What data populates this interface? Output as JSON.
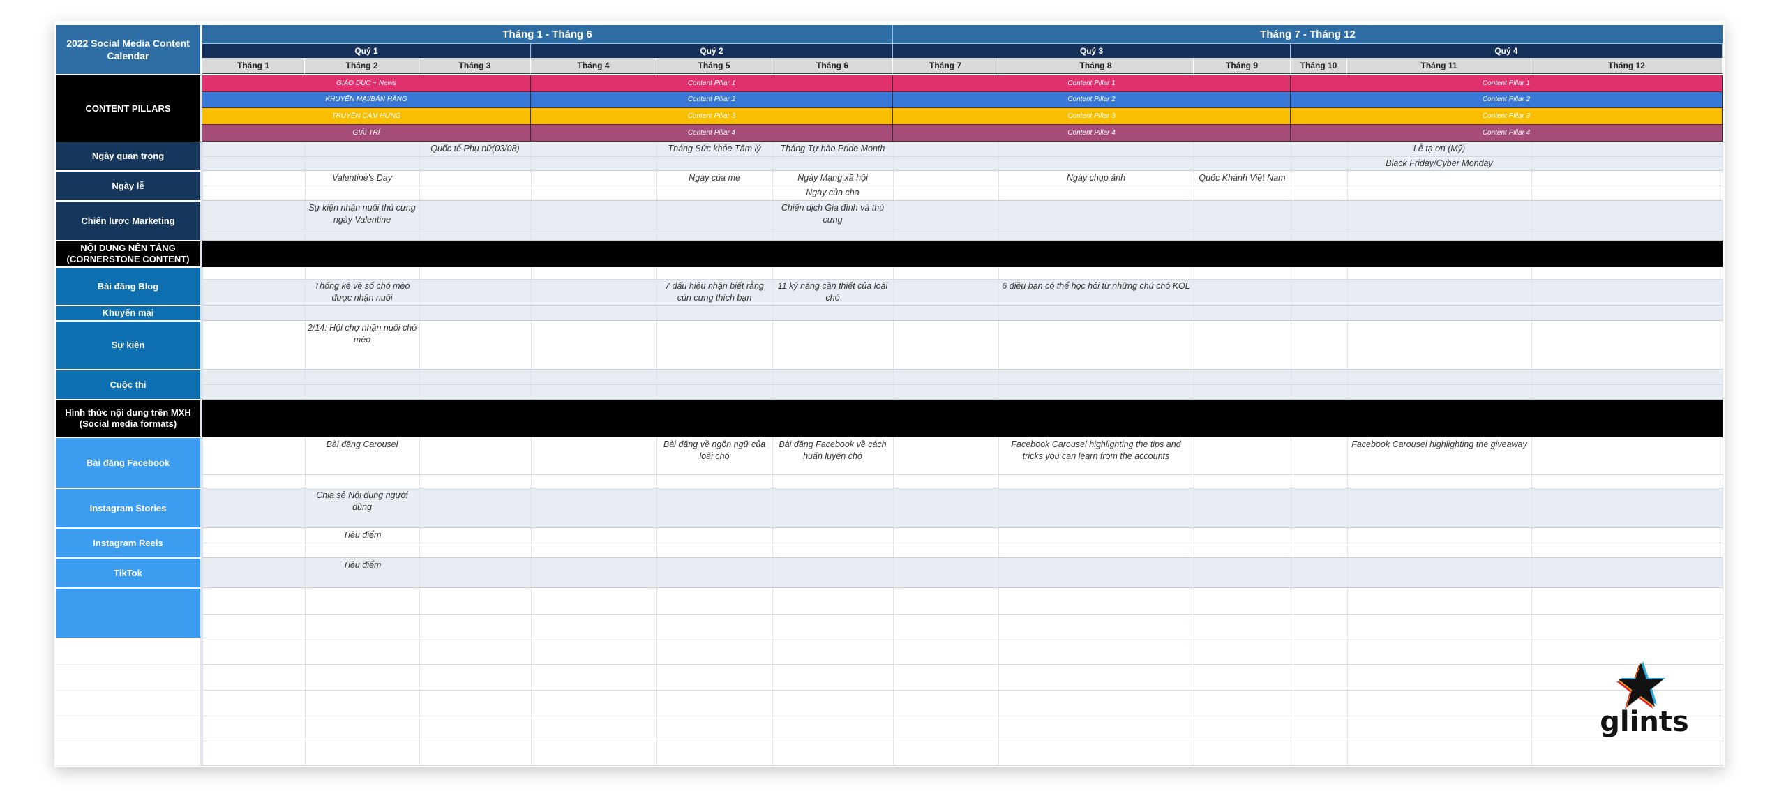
{
  "title": "2022 Social Media Content Calendar",
  "halves": [
    "Tháng 1 - Tháng 6",
    "Tháng 7 - Tháng 12"
  ],
  "quarters": [
    "Quý 1",
    "Quý 2",
    "Quý 3",
    "Quý 4"
  ],
  "months": [
    "Tháng 1",
    "Tháng 2",
    "Tháng 3",
    "Tháng 4",
    "Tháng 5",
    "Tháng 6",
    "Tháng 7",
    "Tháng 8",
    "Tháng 9",
    "Tháng 10",
    "Tháng 11",
    "Tháng 12"
  ],
  "content_pillars": {
    "label": "CONTENT PILLARS",
    "colors": [
      "#e0306e",
      "#3a78d8",
      "#f9be00",
      "#a54d78"
    ],
    "quarters": [
      [
        "GIÁO DỤC + News",
        "KHUYẾN MẠI/BÁN HÀNG",
        "TRUYỀN CẢM HỨNG",
        "GIẢI TRÍ"
      ],
      [
        "Content Pillar 1",
        "Content Pillar 2",
        "Content Pillar 3",
        "Content Pillar 4"
      ],
      [
        "Content Pillar 1",
        "Content Pillar 2",
        "Content Pillar 3",
        "Content Pillar 4"
      ],
      [
        "Content Pillar 1",
        "Content Pillar 2",
        "Content Pillar 3",
        "Content Pillar 4"
      ]
    ]
  },
  "rows": [
    {
      "label": "Ngày quan trọng",
      "entries": [
        {
          "month": 3,
          "line": 1,
          "text": "Quốc tế Phụ nữ(03/08)"
        },
        {
          "month": 5,
          "line": 1,
          "text": "Tháng Sức khỏe Tâm lý"
        },
        {
          "month": 6,
          "line": 1,
          "text": "Tháng Tự hào Pride Month"
        },
        {
          "month": 11,
          "line": 1,
          "text": "Lễ tạ ơn (Mỹ)"
        },
        {
          "month": 11,
          "line": 2,
          "text": "Black Friday/Cyber Monday"
        }
      ]
    },
    {
      "label": "Ngày lễ",
      "entries": [
        {
          "month": 2,
          "line": 1,
          "text": "Valentine's Day"
        },
        {
          "month": 5,
          "line": 1,
          "text": "Ngày của mẹ"
        },
        {
          "month": 6,
          "line": 1,
          "text": "Ngày Mạng xã hội"
        },
        {
          "month": 6,
          "line": 2,
          "text": "Ngày của cha"
        },
        {
          "month": 8,
          "line": 1,
          "text": "Ngày chụp ảnh"
        },
        {
          "month": 9,
          "line": 1,
          "text": "Quốc Khánh Việt Nam"
        }
      ]
    },
    {
      "label": "Chiến lược Marketing",
      "entries": [
        {
          "month": 2,
          "line": 1,
          "text": "Sự kiện nhận nuôi thú cưng ngày Valentine"
        },
        {
          "month": 6,
          "line": 1,
          "text": "Chiến dịch Gia đình và thú cưng"
        }
      ]
    },
    {
      "label": "NỘI DUNG NỀN TẢNG (CORNERSTONE CONTENT)",
      "entries": []
    },
    {
      "label": "Bài đăng Blog",
      "entries": [
        {
          "month": 2,
          "line": 2,
          "text": "Thống kê về số chó mèo được nhận nuôi"
        },
        {
          "month": 5,
          "line": 2,
          "text": "7 dấu hiệu nhận biết rằng cún cưng thích bạn"
        },
        {
          "month": 6,
          "line": 2,
          "text": "11 kỹ năng cần thiết của loài chó"
        },
        {
          "month": 8,
          "line": 2,
          "text": "6 điều bạn có thể học hỏi từ những chú chó KOL"
        }
      ]
    },
    {
      "label": "Khuyến mại",
      "entries": []
    },
    {
      "label": "Sự kiện",
      "entries": [
        {
          "month": 2,
          "line": 1,
          "text": "2/14: Hội chợ nhận nuôi chó mèo"
        }
      ]
    },
    {
      "label": "Cuộc thi",
      "entries": []
    },
    {
      "label": "Hình thức nội dung trên MXH (Social media formats)",
      "entries": []
    },
    {
      "label": "Bài đăng Facebook",
      "entries": [
        {
          "month": 2,
          "line": 1,
          "text": "Bài đăng Carousel"
        },
        {
          "month": 5,
          "line": 1,
          "text": "Bài đăng về ngôn ngữ của loài chó"
        },
        {
          "month": 6,
          "line": 1,
          "text": "Bài đăng Facebook về cách huấn luyện chó"
        },
        {
          "month": 8,
          "line": 1,
          "text": "Facebook Carousel highlighting the tips and tricks you can learn from the accounts"
        },
        {
          "month": 11,
          "line": 1,
          "text": "Facebook Carousel highlighting the giveaway"
        }
      ]
    },
    {
      "label": "Instagram Stories",
      "entries": [
        {
          "month": 2,
          "line": 1,
          "text": "Chia sẻ Nội dung người dùng"
        }
      ]
    },
    {
      "label": "Instagram Reels",
      "entries": [
        {
          "month": 2,
          "line": 1,
          "text": "Tiêu điểm"
        }
      ]
    },
    {
      "label": "TikTok",
      "entries": [
        {
          "month": 2,
          "line": 1,
          "text": "Tiêu điểm"
        }
      ]
    },
    {
      "label": "",
      "entries": []
    }
  ],
  "colors": {
    "title_bg": "#2f6ea5",
    "quarter_bg": "#17305a",
    "month_bg": "#d9d9d9",
    "section_black": "#000000",
    "navy_label": "#16365c",
    "blue_label": "#0e6fb0",
    "light_blue_label": "#3b9cf0",
    "light_row": "#e8edf4"
  },
  "logo": {
    "text": "glints",
    "icon": "star-icon"
  }
}
